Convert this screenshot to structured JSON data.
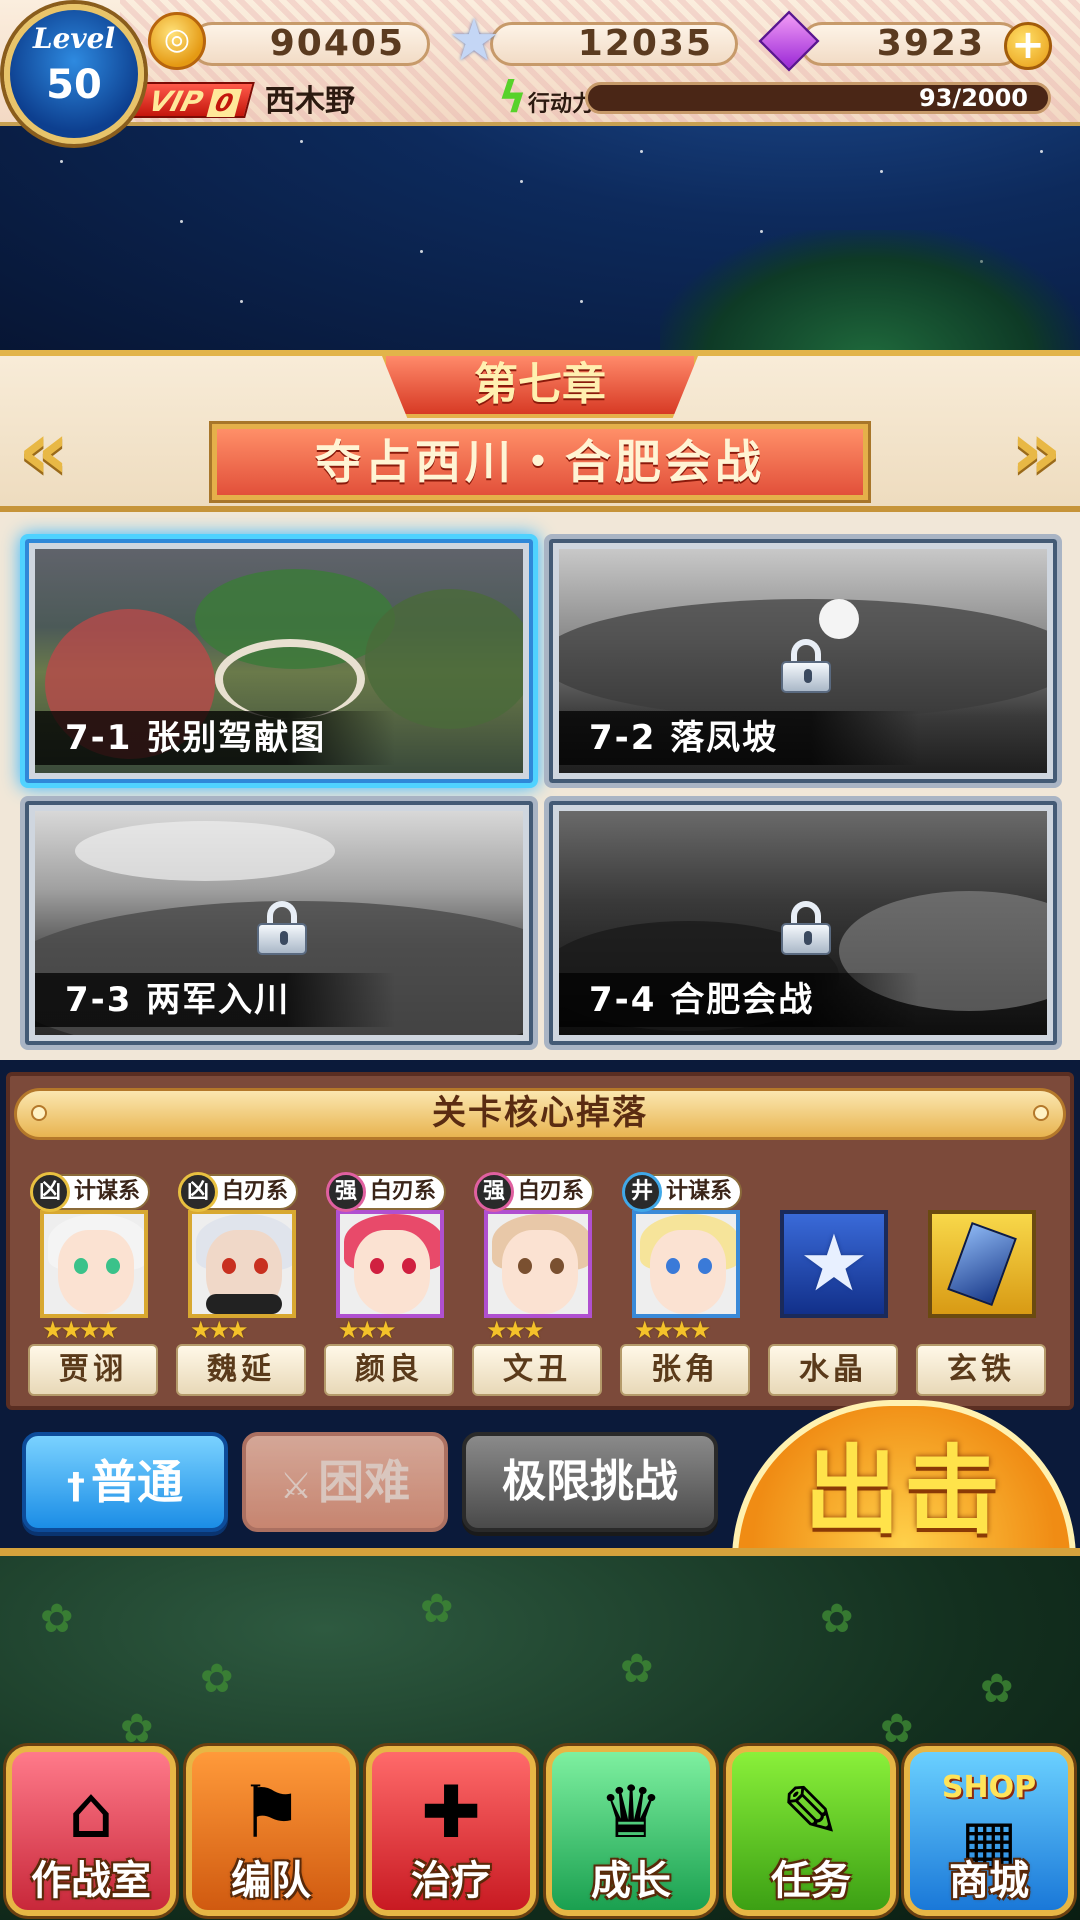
{
  "player": {
    "level_label": "Level",
    "level": "50",
    "name": "西木野",
    "vip_label": "VIP",
    "vip_level": "0"
  },
  "resources": {
    "gold": "90405",
    "stars": "12035",
    "gems": "3923",
    "stamina_label": "行动力",
    "stamina_text": "93/2000",
    "stamina_fraction": 0.0465
  },
  "chapter": {
    "number": "第七章",
    "title": "夺占西川・合肥会战",
    "prev_icon": "double-chevron-left-icon",
    "next_icon": "double-chevron-right-icon"
  },
  "stages": [
    {
      "label": "7-1  张别驾献图",
      "locked": false
    },
    {
      "label": "7-2  落凤坡",
      "locked": true
    },
    {
      "label": "7-3  两军入川",
      "locked": true
    },
    {
      "label": "7-4  合肥会战",
      "locked": true
    }
  ],
  "drops": {
    "title": "关卡核心掉落",
    "items": [
      {
        "badge": "凶",
        "type": "计谋系",
        "name": "贾诩",
        "stars": "★★★★"
      },
      {
        "badge": "凶",
        "type": "白刃系",
        "name": "魏延",
        "stars": "★★★"
      },
      {
        "badge": "强",
        "type": "白刃系",
        "name": "颜良",
        "stars": "★★★"
      },
      {
        "badge": "强",
        "type": "白刃系",
        "name": "文丑",
        "stars": "★★★"
      },
      {
        "badge": "井",
        "type": "计谋系",
        "name": "张角",
        "stars": "★★★★"
      },
      {
        "name": "水晶",
        "icon": "star-crystal-icon"
      },
      {
        "name": "玄铁",
        "icon": "blue-ore-icon"
      }
    ]
  },
  "difficulty": {
    "normal": "普通",
    "hard": "困难",
    "limit": "极限挑战"
  },
  "sortie": "出击",
  "nav": [
    {
      "label": "作战室",
      "icon": "house-icon"
    },
    {
      "label": "编队",
      "icon": "banner-horn-icon"
    },
    {
      "label": "治疗",
      "icon": "medkit-icon"
    },
    {
      "label": "成长",
      "icon": "trophy-icon"
    },
    {
      "label": "任务",
      "icon": "notepad-icon"
    },
    {
      "label": "商城",
      "icon": "shop-icon",
      "sign": "SHOP"
    }
  ],
  "colors": {
    "accent_gold": "#e7b645",
    "banner_red": "#e2503a",
    "normal_blue": "#1b8de6"
  }
}
